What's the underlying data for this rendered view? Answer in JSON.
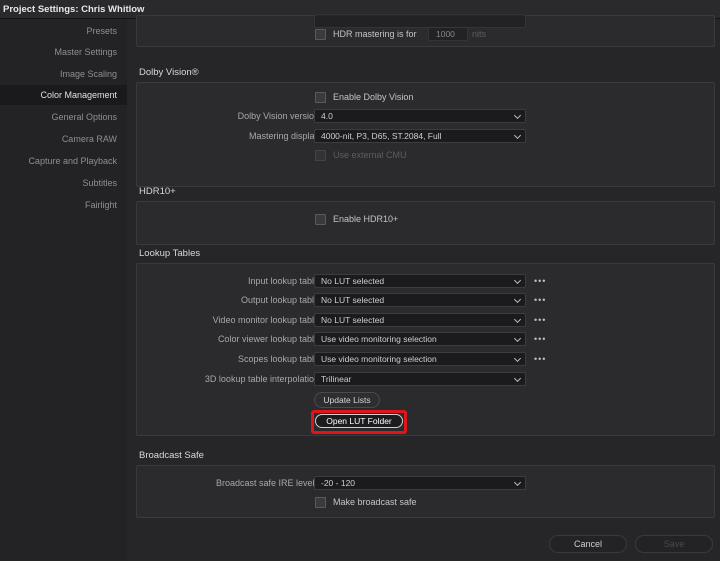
{
  "window": {
    "title": "Project Settings:  Chris Whitlow"
  },
  "sidebar": {
    "items": [
      {
        "label": "Presets"
      },
      {
        "label": "Master Settings"
      },
      {
        "label": "Image Scaling"
      },
      {
        "label": "Color Management",
        "active": true
      },
      {
        "label": "General Options"
      },
      {
        "label": "Camera RAW"
      },
      {
        "label": "Capture and Playback"
      },
      {
        "label": "Subtitles"
      },
      {
        "label": "Fairlight"
      }
    ]
  },
  "hdr_mastering": {
    "checkbox_label": "HDR mastering is for",
    "value": "1000",
    "unit": "nits"
  },
  "dolby_vision": {
    "title": "Dolby Vision®",
    "enable_label": "Enable Dolby Vision",
    "version_label": "Dolby Vision version",
    "version_value": "4.0",
    "mastering_label": "Mastering display",
    "mastering_value": "4000-nit, P3, D65, ST.2084, Full",
    "external_cmu_label": "Use external CMU"
  },
  "hdr10": {
    "title": "HDR10+",
    "enable_label": "Enable HDR10+"
  },
  "lookup_tables": {
    "title": "Lookup Tables",
    "rows": [
      {
        "label": "Input lookup table",
        "value": "No LUT selected",
        "more": "•••"
      },
      {
        "label": "Output lookup table",
        "value": "No LUT selected",
        "more": "•••"
      },
      {
        "label": "Video monitor lookup table",
        "value": "No LUT selected",
        "more": "•••"
      },
      {
        "label": "Color viewer lookup table",
        "value": "Use video monitoring selection",
        "more": "•••"
      },
      {
        "label": "Scopes lookup table",
        "value": "Use video monitoring selection",
        "more": "•••"
      },
      {
        "label": "3D lookup table interpolation",
        "value": "Trilinear"
      }
    ],
    "update_button": "Update Lists",
    "open_folder_button": "Open LUT Folder"
  },
  "broadcast_safe": {
    "title": "Broadcast Safe",
    "ire_label": "Broadcast safe IRE levels",
    "ire_value": "-20 - 120",
    "make_safe_label": "Make broadcast safe"
  },
  "footer": {
    "cancel": "Cancel",
    "save": "Save"
  },
  "colors": {
    "highlight": "#e0141b",
    "background": "#262629"
  }
}
